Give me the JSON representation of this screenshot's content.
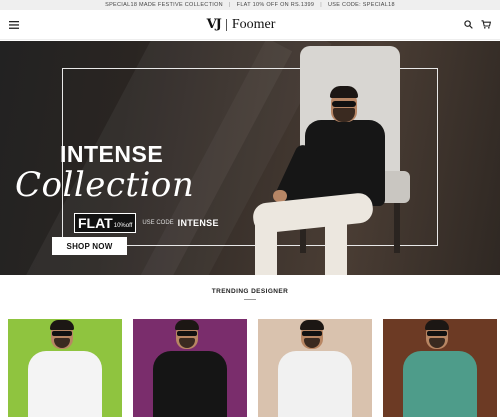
{
  "announcement": {
    "items": [
      "SPECIAL18 MADE FESTIVE COLLECTION",
      "FLAT 10% OFF ON RS.1399",
      "USE CODE: SPECIAL18"
    ],
    "separator": "|"
  },
  "header": {
    "logo_mark": "VJ",
    "brand_name": "Foomer",
    "icons": [
      "menu-icon",
      "search-icon",
      "cart-icon"
    ]
  },
  "hero": {
    "title_line1": "INTENSE",
    "title_line2": "Collection",
    "flat_text": "FLAT",
    "discount_text": "10%off",
    "code_label": "USE CODE",
    "code_value": "INTENSE",
    "cta_label": "SHOP NOW"
  },
  "trending": {
    "title": "TRENDING DESIGNER",
    "products": [
      {
        "bg": "#8fc43f",
        "shirt": "#f4f4f4"
      },
      {
        "bg": "#7a2d6c",
        "shirt": "#151515"
      },
      {
        "bg": "#d9c2ae",
        "shirt": "#f1f1f1"
      },
      {
        "bg": "#6c3a24",
        "shirt": "#4e9c8a"
      }
    ]
  },
  "colors": {
    "accent": "#111111",
    "hero_frame": "#e8e8e8"
  }
}
